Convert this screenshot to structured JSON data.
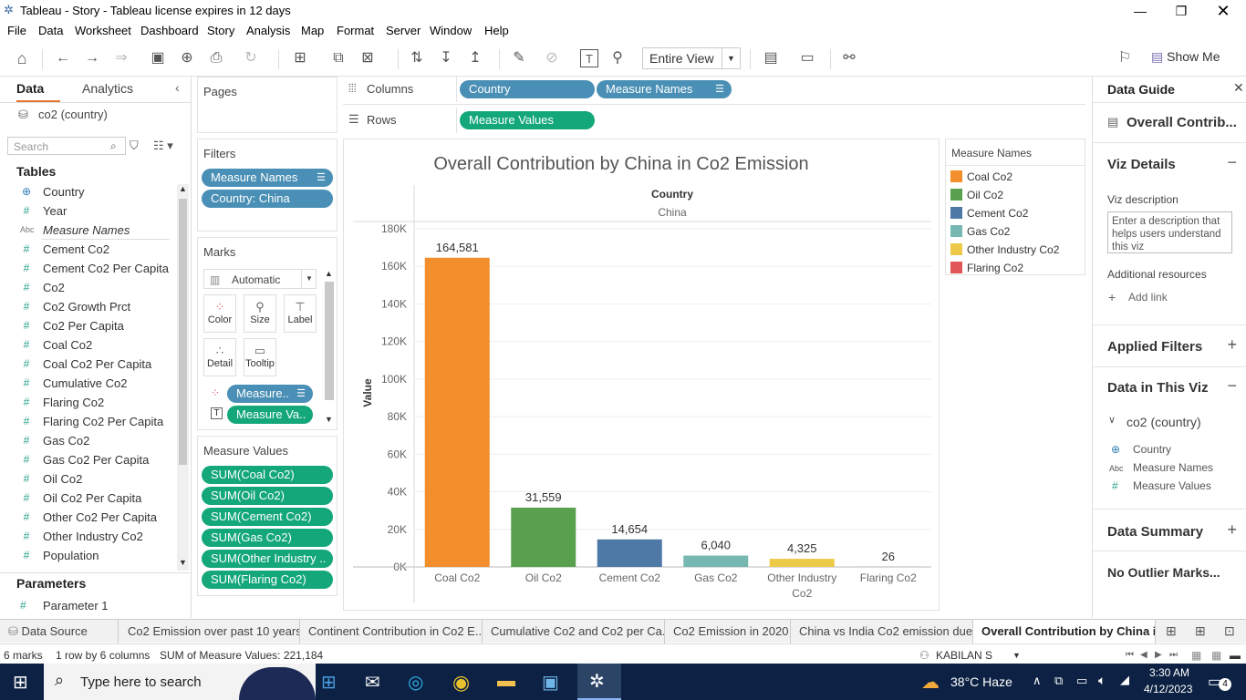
{
  "window": {
    "title": "Tableau - Story - Tableau license expires in 12 days"
  },
  "menu": [
    "File",
    "Data",
    "Worksheet",
    "Dashboard",
    "Story",
    "Analysis",
    "Map",
    "Format",
    "Server",
    "Window",
    "Help"
  ],
  "toolbar": {
    "view_mode": "Entire View",
    "show_me": "Show Me"
  },
  "datapane": {
    "tab_data": "Data",
    "tab_analytics": "Analytics",
    "datasource": "co2 (country)",
    "search_placeholder": "Search",
    "tables_heading": "Tables",
    "fields": [
      {
        "type": "globe",
        "name": "Country"
      },
      {
        "type": "#",
        "name": "Year"
      },
      {
        "type": "abc",
        "name": "Measure Names"
      },
      {
        "type": "#",
        "name": "Cement Co2"
      },
      {
        "type": "#",
        "name": "Cement Co2 Per Capita"
      },
      {
        "type": "#",
        "name": "Co2"
      },
      {
        "type": "#",
        "name": "Co2 Growth Prct"
      },
      {
        "type": "#",
        "name": "Co2 Per Capita"
      },
      {
        "type": "#",
        "name": "Coal Co2"
      },
      {
        "type": "#",
        "name": "Coal Co2 Per Capita"
      },
      {
        "type": "#",
        "name": "Cumulative Co2"
      },
      {
        "type": "#",
        "name": "Flaring Co2"
      },
      {
        "type": "#",
        "name": "Flaring Co2 Per Capita"
      },
      {
        "type": "#",
        "name": "Gas Co2"
      },
      {
        "type": "#",
        "name": "Gas Co2 Per Capita"
      },
      {
        "type": "#",
        "name": "Oil Co2"
      },
      {
        "type": "#",
        "name": "Oil Co2 Per Capita"
      },
      {
        "type": "#",
        "name": "Other Co2 Per Capita"
      },
      {
        "type": "#",
        "name": "Other Industry Co2"
      },
      {
        "type": "#",
        "name": "Population"
      }
    ],
    "parameters_heading": "Parameters",
    "parameter": "Parameter 1"
  },
  "shelves": {
    "pages": "Pages",
    "filters": "Filters",
    "filter_pills": [
      "Measure Names",
      "Country: China"
    ],
    "marks": "Marks",
    "mark_type": "Automatic",
    "mark_buttons": [
      "Color",
      "Size",
      "Label",
      "Detail",
      "Tooltip"
    ],
    "mark_pills": [
      "Measure..",
      "Measure Va.."
    ],
    "measure_values_title": "Measure Values",
    "measure_values": [
      "SUM(Coal Co2)",
      "SUM(Oil Co2)",
      "SUM(Cement Co2)",
      "SUM(Gas Co2)",
      "SUM(Other Industry ..",
      "SUM(Flaring Co2)"
    ],
    "columns_label": "Columns",
    "rows_label": "Rows",
    "column_pills": [
      "Country",
      "Measure Names"
    ],
    "row_pills": [
      "Measure Values"
    ]
  },
  "chart_data": {
    "type": "bar",
    "title": "Overall Contribution by China in Co2 Emission",
    "header_field": "Country",
    "header_value": "China",
    "ylabel": "Value",
    "categories": [
      "Coal Co2",
      "Oil Co2",
      "Cement Co2",
      "Gas Co2",
      "Other Industry Co2",
      "Flaring Co2"
    ],
    "values": [
      164581,
      31559,
      14654,
      6040,
      4325,
      26
    ],
    "value_labels": [
      "164,581",
      "31,559",
      "14,654",
      "6,040",
      "4,325",
      "26"
    ],
    "colors": [
      "#f28e2b",
      "#59a14f",
      "#4e79a7",
      "#76b7b2",
      "#edc948",
      "#e15759"
    ],
    "ylim": [
      0,
      180000
    ],
    "yticks": [
      0,
      20000,
      40000,
      60000,
      80000,
      100000,
      120000,
      140000,
      160000,
      180000
    ],
    "ytick_labels": [
      "0K",
      "20K",
      "40K",
      "60K",
      "80K",
      "100K",
      "120K",
      "140K",
      "160K",
      "180K"
    ],
    "grid": true
  },
  "legend": {
    "title": "Measure Names",
    "items": [
      "Coal Co2",
      "Oil Co2",
      "Cement Co2",
      "Gas Co2",
      "Other Industry Co2",
      "Flaring Co2"
    ]
  },
  "guide": {
    "title": "Data Guide",
    "sheet": "Overall Contrib...",
    "viz_details": "Viz Details",
    "viz_description_label": "Viz description",
    "viz_description_placeholder": "Enter a description that helps users understand this viz",
    "additional_resources": "Additional resources",
    "add_link": "Add link",
    "applied_filters": "Applied Filters",
    "data_in_viz": "Data in This Viz",
    "datasource": "co2 (country)",
    "fields": [
      "Country",
      "Measure Names",
      "Measure Values"
    ],
    "data_summary": "Data Summary",
    "no_outlier": "No Outlier Marks..."
  },
  "sheet_tabs": [
    "Data Source",
    "Co2 Emission over past 10 years",
    "Continent Contribution in Co2 E...",
    "Cumulative Co2 and Co2 per Ca...",
    "Co2 Emission in 2020",
    "China vs India Co2 emission due...",
    "Overall Contribution by China i..."
  ],
  "status": {
    "marks": "6 marks",
    "shape": "1 row by 6 columns",
    "sum": "SUM of Measure Values: 221,184",
    "user": "KABILAN S"
  },
  "taskbar": {
    "search": "Type here to search",
    "weather": "38°C  Haze",
    "time": "3:30 AM",
    "date": "4/12/2023",
    "notifications": "4"
  }
}
